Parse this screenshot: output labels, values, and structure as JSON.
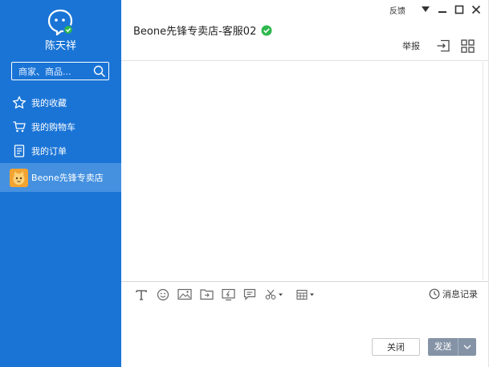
{
  "sidebar": {
    "user_name": "陈天祥",
    "search_placeholder": "商家、商品...",
    "nav": [
      {
        "label": "我的收藏",
        "icon": "star-icon"
      },
      {
        "label": "我的购物车",
        "icon": "cart-icon"
      },
      {
        "label": "我的订单",
        "icon": "order-icon"
      }
    ],
    "active_shop": {
      "label": "Beone先锋专卖店",
      "icon": "shop-avatar-icon"
    }
  },
  "window": {
    "feedback_label": "反馈",
    "controls": [
      "dropdown-icon",
      "minimize-icon",
      "maximize-icon",
      "close-icon"
    ]
  },
  "chat": {
    "title": "Beone先锋专卖店-客服02",
    "verified_icon": "verified-check-icon",
    "report_label": "举报",
    "header_icons": [
      "transfer-icon",
      "grid-icon"
    ]
  },
  "toolbar": {
    "icons": [
      "text-format-icon",
      "emoji-icon",
      "image-icon",
      "file-icon",
      "screen-share-icon",
      "quick-reply-icon",
      "screenshot-icon",
      "calendar-icon"
    ],
    "history_label": "消息记录"
  },
  "actions": {
    "close_label": "关闭",
    "send_label": "发送"
  },
  "colors": {
    "sidebar_bg": "#1a74d6",
    "active_item_bg": "#4591e0",
    "send_button_bg": "#8493a6",
    "verified_green": "#2db84d"
  }
}
